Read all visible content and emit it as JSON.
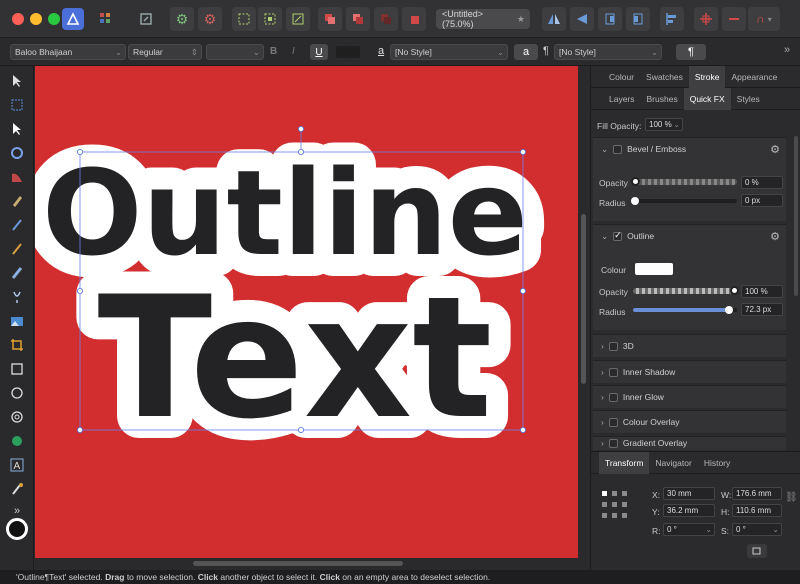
{
  "document_tab": {
    "title": "<Untitled> (75.0%)",
    "close_glyph": "★"
  },
  "context_bar": {
    "font_family": "Baloo Bhaijaan",
    "font_style": "Regular",
    "font_size": "",
    "bold": "B",
    "italic": "I",
    "underline": "U",
    "char_style_glyph": "a",
    "char_style": "[No Style]",
    "para_button": "a",
    "para_glyph": "¶",
    "para_style": "[No Style]",
    "pilcrow": "¶"
  },
  "canvas": {
    "line1": "Outline",
    "line2": "Text",
    "background_color": "#d22e30",
    "text_color": "#232325",
    "outline_color": "#ffffff"
  },
  "panel": {
    "tabs_top": [
      "Colour",
      "Swatches",
      "Stroke",
      "Appearance"
    ],
    "tabs_top_active": "Stroke",
    "tabs_second": [
      "Layers",
      "Brushes",
      "Quick FX",
      "Styles"
    ],
    "tabs_second_active": "Quick FX",
    "fill_opacity_label": "Fill Opacity:",
    "fill_opacity_value": "100 %",
    "bevel": {
      "title": "Bevel / Emboss",
      "opacity_label": "Opacity",
      "opacity_value": "0 %",
      "opacity_level": 0,
      "radius_label": "Radius",
      "radius_value": "0 px",
      "radius_level": 0
    },
    "outline": {
      "title": "Outline",
      "colour_label": "Colour",
      "opacity_label": "Opacity",
      "opacity_value": "100 %",
      "opacity_level": 1,
      "radius_label": "Radius",
      "radius_value": "72.3 px",
      "radius_level": 0.93
    },
    "effects": [
      "3D",
      "Inner Shadow",
      "Inner Glow",
      "Colour Overlay",
      "Gradient Overlay"
    ],
    "bottom_tabs": [
      "Transform",
      "Navigator",
      "History"
    ],
    "bottom_tabs_active": "Transform",
    "transform": {
      "x_label": "X:",
      "x_value": "30 mm",
      "y_label": "Y:",
      "y_value": "36.2 mm",
      "w_label": "W:",
      "w_value": "176.6 mm",
      "h_label": "H:",
      "h_value": "110.6 mm",
      "r_label": "R:",
      "r_value": "0 °",
      "s_label": "S:",
      "s_value": "0 °"
    }
  },
  "status": {
    "part1": "'Outline¶Text' selected. ",
    "drag": "Drag",
    "part2": " to move selection. ",
    "click1": "Click",
    "part3": " another object to select it. ",
    "click2": "Click",
    "part4": " on an empty area to deselect selection."
  },
  "colors": {
    "accent": "#4a6fd8",
    "app_icon": "#3b6fd6"
  }
}
